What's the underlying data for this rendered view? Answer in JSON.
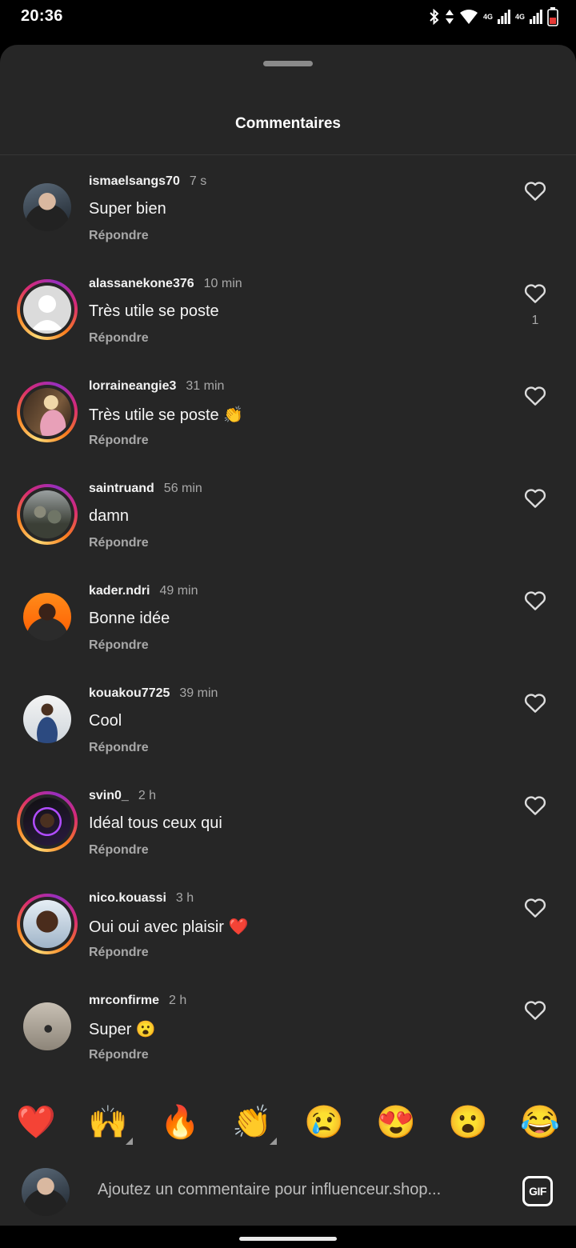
{
  "status_bar": {
    "time": "20:36",
    "network_label_1": "4G",
    "network_label_2": "4G",
    "icons": [
      "bluetooth-icon",
      "data-arrows-icon",
      "wifi-icon",
      "signal-icon",
      "signal-icon",
      "battery-icon"
    ]
  },
  "sheet": {
    "title": "Commentaires"
  },
  "comments": [
    {
      "user": "ismaelsangs70",
      "time": "7 s",
      "text": "Super bien",
      "reply": "Répondre",
      "likes": ""
    },
    {
      "user": "alassanekone376",
      "time": "10 min",
      "text": "Très utile se poste",
      "reply": "Répondre",
      "likes": "1"
    },
    {
      "user": "lorraineangie3",
      "time": "31 min",
      "text": "Très utile se poste 👏",
      "reply": "Répondre",
      "likes": ""
    },
    {
      "user": "saintruand",
      "time": "56 min",
      "text": "damn",
      "reply": "Répondre",
      "likes": ""
    },
    {
      "user": "kader.ndri",
      "time": "49 min",
      "text": "Bonne idée",
      "reply": "Répondre",
      "likes": ""
    },
    {
      "user": "kouakou7725",
      "time": "39 min",
      "text": "Cool",
      "reply": "Répondre",
      "likes": ""
    },
    {
      "user": "svin0_",
      "time": "2 h",
      "text": "Idéal tous ceux qui",
      "reply": "Répondre",
      "likes": ""
    },
    {
      "user": "nico.kouassi",
      "time": "3 h",
      "text": "Oui oui avec plaisir ❤️",
      "reply": "Répondre",
      "likes": ""
    },
    {
      "user": "mrconfirme",
      "time": "2 h",
      "text": "Super 😮",
      "reply": "Répondre",
      "likes": ""
    }
  ],
  "quick_reactions": [
    "❤️",
    "🙌",
    "🔥",
    "👏",
    "😢",
    "😍",
    "😮",
    "😂"
  ],
  "composer": {
    "placeholder": "Ajoutez un commentaire pour influenceur.shop...",
    "gif_label": "GIF"
  },
  "colors": {
    "sheet_bg": "#262626",
    "secondary_text": "#a8a8a8",
    "story_ring": [
      "#feda75",
      "#fa7e1e",
      "#d62976",
      "#962fbf"
    ]
  }
}
